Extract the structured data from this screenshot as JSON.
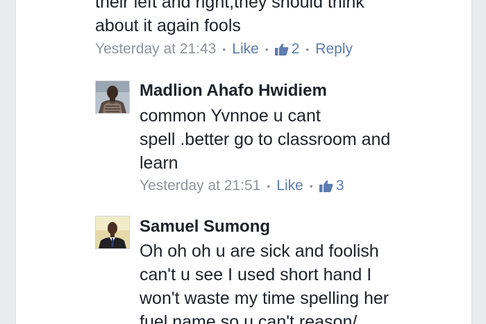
{
  "top_comment": {
    "lines": [
      "their left and right,they should think",
      "about it again fools"
    ],
    "time": "Yesterday at 21:43",
    "like_label": "Like",
    "like_count": "2",
    "reply_label": "Reply"
  },
  "replies": [
    {
      "author": "Madlion Ahafo Hwidiem",
      "lines": [
        "common Yvnnoe u cant",
        "spell .better go to classroom and",
        "learn"
      ],
      "time": "Yesterday at 21:51",
      "like_label": "Like",
      "like_count": "3"
    },
    {
      "author": "Samuel Sumong",
      "lines": [
        "Oh oh oh u are sick and foolish",
        "can't u see I used short hand I",
        "won't waste my time spelling her",
        "fuel name so u can't reason/"
      ]
    }
  ],
  "icons": {
    "like_count_icon": "thumbs-up-icon",
    "separator": "•"
  },
  "colors": {
    "link": "#5d7cb0",
    "meta": "#90949c",
    "text": "#1d2129",
    "background": "#e9ebee"
  }
}
